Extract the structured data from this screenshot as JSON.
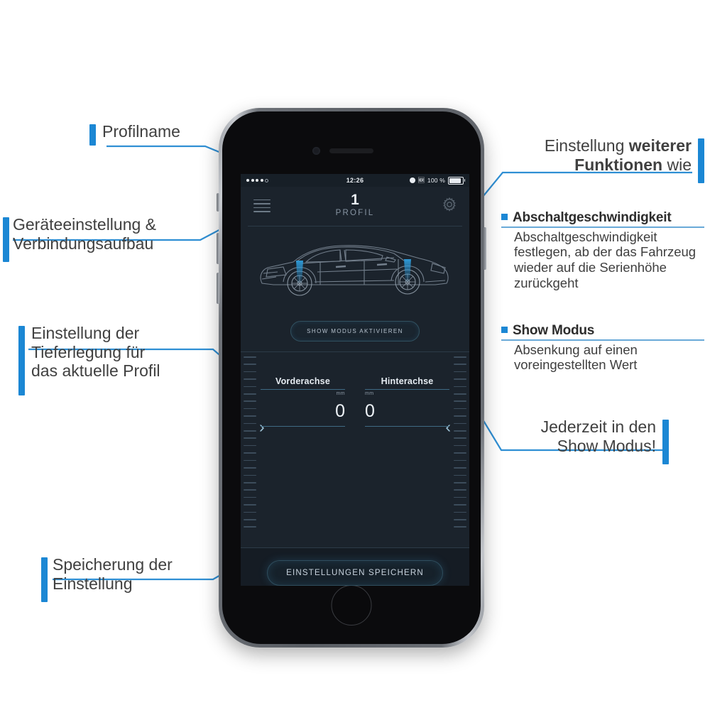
{
  "phone": {
    "status_bar": {
      "time": "12:26",
      "battery_text": "100 %",
      "signal_icon": "signal-dots-icon",
      "lock_icon": "lock-icon",
      "bluetooth_icon": "bluetooth-icon",
      "battery_icon": "battery-full-icon"
    },
    "header": {
      "menu_icon": "hamburger-menu-icon",
      "settings_icon": "gear-icon",
      "profile_number": "1",
      "profile_label": "PROFIL"
    },
    "car_illustration": {
      "alt": "car-wireframe-icon"
    },
    "show_mode_button": "SHOW MODUS AKTIVIEREN",
    "axes": {
      "front": {
        "title": "Vorderachse",
        "unit": "mm",
        "value": "0",
        "chevron": "›"
      },
      "rear": {
        "title": "Hinterachse",
        "unit": "mm",
        "value": "0",
        "chevron": "‹"
      }
    },
    "save_button": "EINSTELLUNGEN SPEICHERN"
  },
  "annotations": {
    "profile_name": "Profilname",
    "device_setting_line1": "Geräteeinstellung &",
    "device_setting_line2": "Verbindungsaufbau",
    "lowering_line1": "Einstellung der",
    "lowering_line2": "Tieferlegung für",
    "lowering_line3": "das aktuelle Profil",
    "saving_line1": "Speicherung der",
    "saving_line2": "Einstellung",
    "more_functions_line1_normal": "Einstellung ",
    "more_functions_line1_bold": "weiterer",
    "more_functions_line2_bold": "Funktionen",
    "more_functions_line2_normal": " wie",
    "anytime_line1": "Jederzeit in den",
    "anytime_line2": "Show Modus!"
  },
  "info_items": [
    {
      "heading": "Abschaltgeschwindigkeit",
      "body": "Abschaltgeschwindigkeit festlegen, ab der das Fahrzeug wieder auf die Serienhöhe zurückgeht"
    },
    {
      "heading": "Show Modus",
      "body": "Absenkung auf einen voreingestellten Wert"
    }
  ],
  "colors": {
    "accent_blue": "#1b87d4",
    "screen_bg": "#1b232c",
    "line_blue": "#1f82c8"
  }
}
